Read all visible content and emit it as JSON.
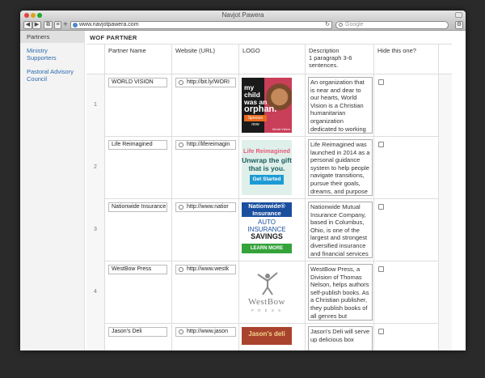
{
  "window": {
    "title": "Navjot Pawera"
  },
  "toolbar": {
    "back_label": "◀",
    "forward_label": "▶",
    "share_label": "⧉",
    "menu_label": "≡",
    "add_label": "+",
    "url": "www.navjotpawera.com",
    "reload_label": "↻",
    "search_placeholder": "Google",
    "gear_label": "⚙"
  },
  "sidebar": {
    "items": [
      {
        "label": "Partners"
      },
      {
        "label": "Ministry Supporters"
      },
      {
        "label": "Pastoral Advisory Council"
      }
    ]
  },
  "main": {
    "section_title": "WOF PARTNER",
    "columns": {
      "name": "Partner Name",
      "website": "Website (URL)",
      "logo": "LOGO",
      "description": "Description\n1 paragraph 3-6 sentences.",
      "hide": "Hide this one?"
    },
    "rows": [
      {
        "index": "1",
        "name": "WORLD VISION",
        "website": "http://bit.ly/WORI",
        "description": "An organization that is near and dear to our hearts, World Vision is a Christian humanitarian organization dedicated to working with children,",
        "logo": {
          "line1": "my",
          "line2": "child",
          "line3": "was an",
          "line4": "orphan.",
          "button": "Sponsor now",
          "brand": "World Vision"
        }
      },
      {
        "index": "2",
        "name": "Life Reimagined",
        "website": "http://lifereimagin",
        "description": "Life Reimagined was launched in 2014 as a personal guidance system to help people navigate transitions, pursue their goals, dreams, and purpose in life.",
        "logo": {
          "title": "Life Reimagined",
          "sub": "Unwrap the gift that is you.",
          "button": "Get Started"
        }
      },
      {
        "index": "3",
        "name": "Nationwide Insurance",
        "website": "http://www.natior",
        "description": "Nationwide Mutual Insurance Company, based in Columbus, Ohio, is one of the largest and strongest diversified insurance and financial services organizations in the",
        "logo": {
          "brand": "Nationwide®",
          "brand_sub": "Insurance",
          "line1": "AUTO",
          "line2": "INSURANCE",
          "line3": "SAVINGS",
          "button": "LEARN MORE"
        }
      },
      {
        "index": "4",
        "name": "WestBow Press",
        "website": "http://www.westk",
        "description": "WestBow Press, a Division of Thomas Nelson, helps authors self-publish books. As a Christian publisher, they publish books of all genres but specialize",
        "logo": {
          "name": "WestBow",
          "sub": "P R E S S"
        }
      },
      {
        "index": "5",
        "name": "Jason's Deli",
        "website": "http://www.jason",
        "description": "Jason's Deli will serve up delicious box",
        "logo": {
          "name": "Jason's deli"
        }
      }
    ]
  }
}
